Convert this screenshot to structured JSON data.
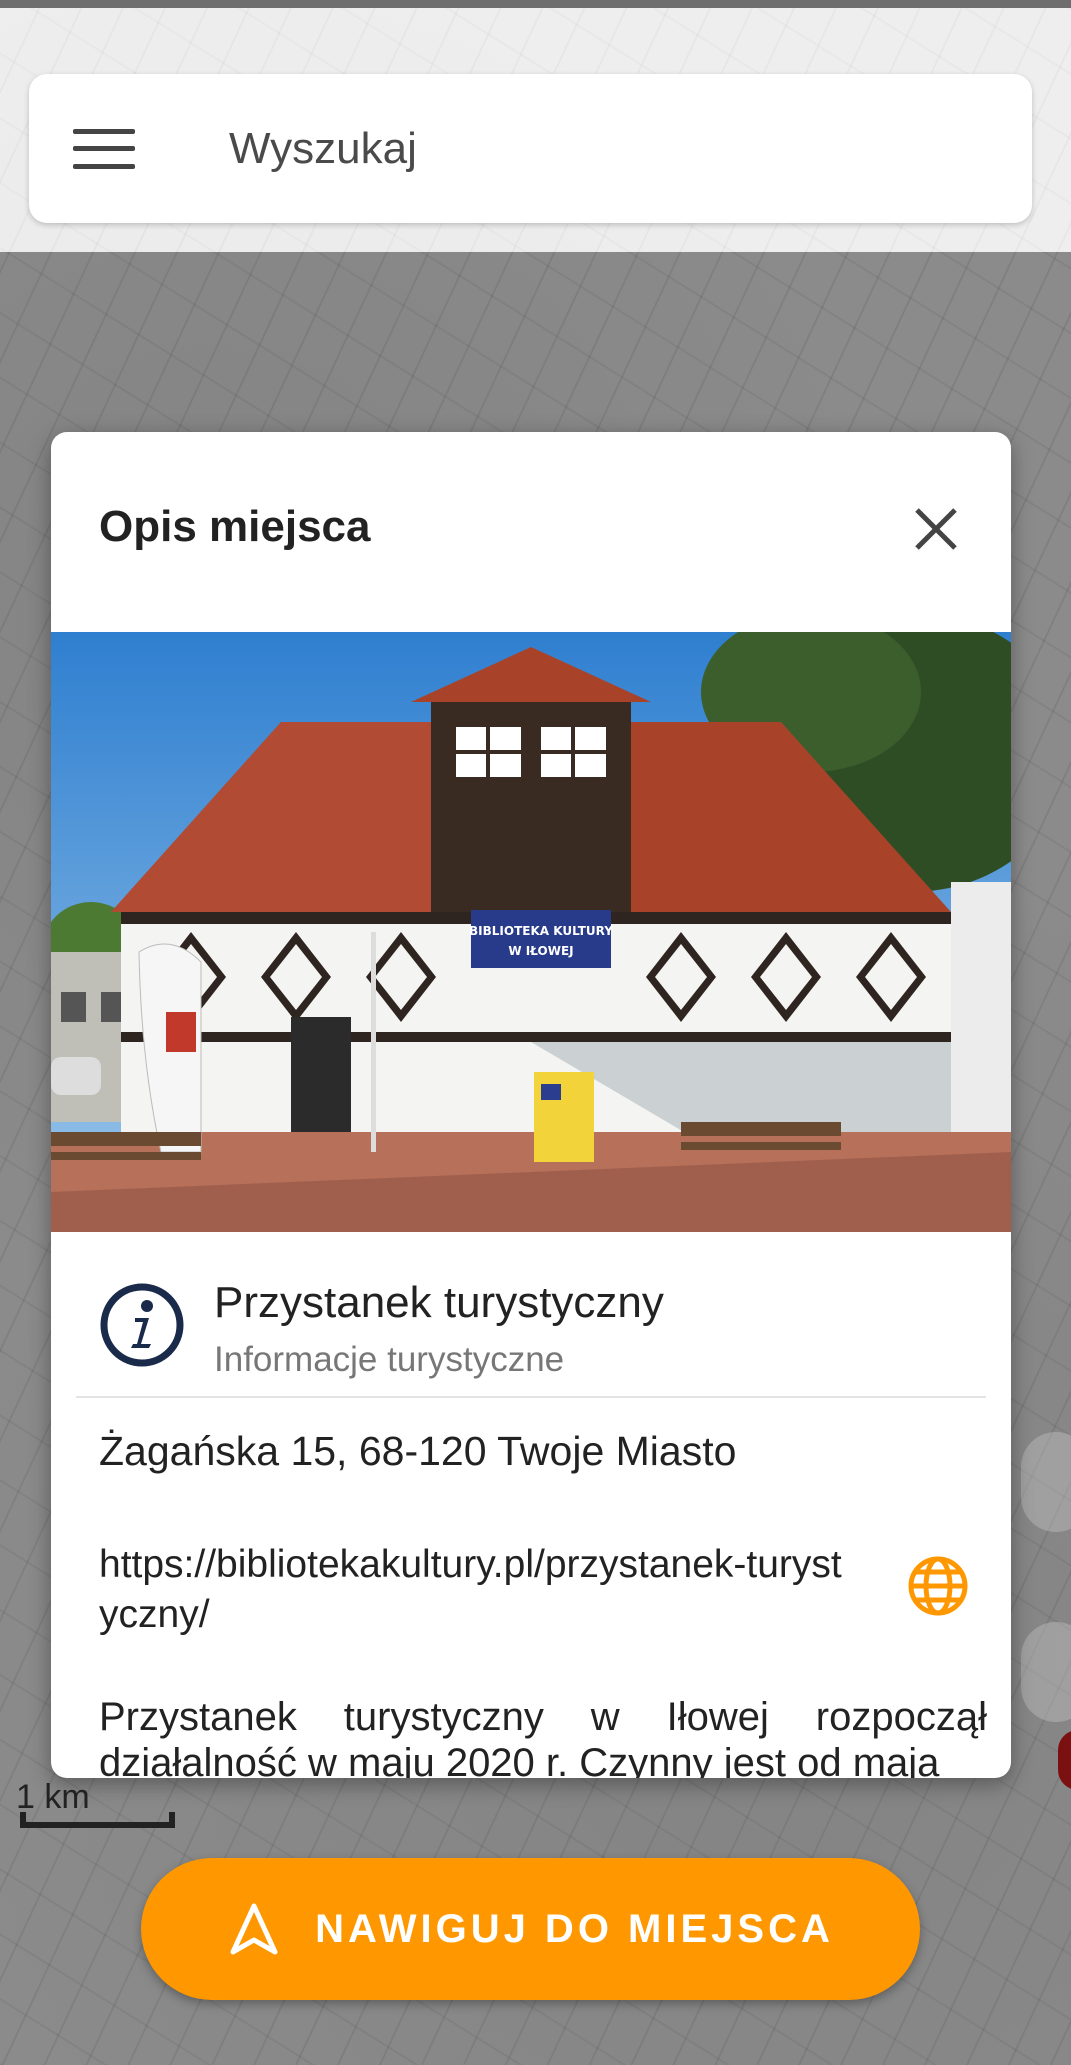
{
  "search": {
    "placeholder": "Wyszukaj"
  },
  "dialog": {
    "title": "Opis miejsca",
    "photo": {
      "sign_text": "BIBLIOTEKA KULTURY W IŁOWEJ"
    },
    "place": {
      "name": "Przystanek turystyczny",
      "category": "Informacje turystyczne"
    },
    "address": "Żagańska 15, 68-120 Twoje Miasto",
    "website": "https://bibliotekakultury.pl/przystanek-turystyczny/",
    "description": "Przystanek turystyczny w Iłowej rozpoczął działalność w maju 2020 r. Czynny jest od maja"
  },
  "map": {
    "scale_label": "1 km"
  },
  "navigate_button": {
    "label": "NAWIGUJ DO MIEJSCA"
  },
  "colors": {
    "accent": "#ff9800",
    "info_icon": "#1a2a4a"
  },
  "icons": [
    "menu-icon",
    "close-icon",
    "info-icon",
    "globe-icon",
    "navigation-arrow-icon"
  ]
}
